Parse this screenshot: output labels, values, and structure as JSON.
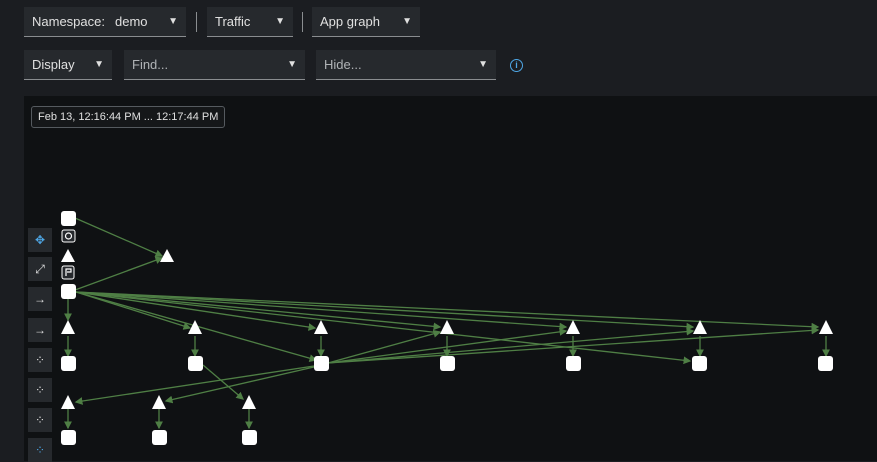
{
  "toolbar": {
    "namespace_label": "Namespace:",
    "namespace_value": "demo",
    "traffic_label": "Traffic",
    "graph_type_label": "App graph",
    "display_label": "Display",
    "find_placeholder": "Find...",
    "hide_placeholder": "Hide..."
  },
  "graph": {
    "time_range": "Feb 13, 12:16:44 PM ... 12:17:44 PM"
  },
  "side_tools": [
    {
      "name": "graph-layout-icon",
      "glyph": "✥",
      "active": true
    },
    {
      "name": "zoom-fit-icon",
      "glyph": "⤢",
      "active": false
    },
    {
      "name": "zoom-in-icon",
      "glyph": "→",
      "active": false
    },
    {
      "name": "zoom-out-icon",
      "glyph": "→",
      "active": false
    },
    {
      "name": "layout-default-icon",
      "glyph": "⁘",
      "active": false
    },
    {
      "name": "layout-1-icon",
      "glyph": "⁘",
      "active": false
    },
    {
      "name": "layout-2-icon",
      "glyph": "⁘",
      "active": false
    },
    {
      "name": "layout-3-icon",
      "glyph": "⁘",
      "active": true
    }
  ],
  "colors": {
    "edge": "#4f7f45",
    "node": "#ffffff",
    "accent": "#4ea7e6",
    "canvas": "#0f1113"
  }
}
